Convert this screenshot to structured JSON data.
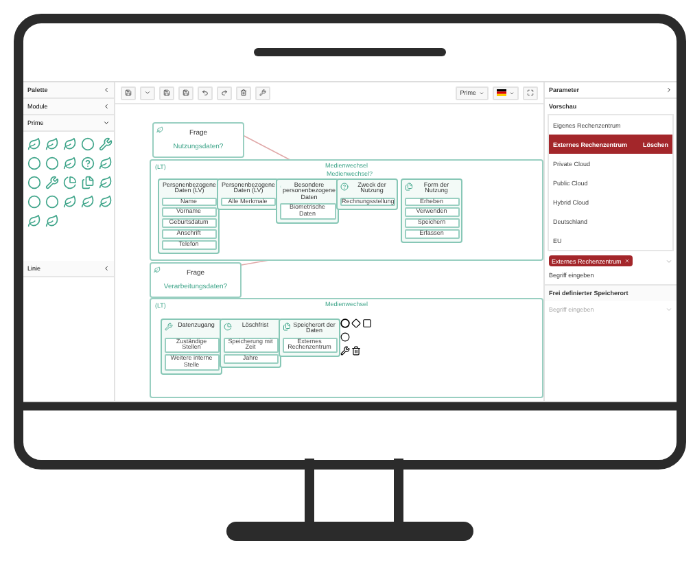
{
  "palette": {
    "title": "Palette",
    "sections": [
      {
        "label": "Module",
        "expanded": false
      },
      {
        "label": "Prime",
        "expanded": true
      },
      {
        "label": "Linie",
        "expanded": false
      }
    ]
  },
  "toolbar": {
    "view": "Prime"
  },
  "canvas": {
    "questions": [
      {
        "title": "Frage",
        "text": "Nutzungsdaten?"
      },
      {
        "title": "Frage",
        "text": "Verarbeitungsdaten?"
      }
    ],
    "groups": [
      {
        "tag": "(LT)",
        "title": "Medienwechsel",
        "note": "Medienwechsel?",
        "nodes": [
          {
            "title": "Personenbezogene Daten (LV)",
            "items": [
              "Name",
              "Vorname",
              "Geburtsdatum",
              "Anschrift",
              "Telefon"
            ]
          },
          {
            "title": "Personenbezogene Daten (LV)",
            "items": [
              "Alle Merkmale"
            ]
          },
          {
            "title": "Besondere personenbezogene Daten",
            "items": [
              "Biometrische Daten"
            ]
          },
          {
            "title": "Zweck der Nutzung",
            "items": [
              "Rechnungsstellung"
            ]
          },
          {
            "title": "Form der Nutzung",
            "items": [
              "Erheben",
              "Verwenden",
              "Speichern",
              "Erfassen"
            ]
          }
        ]
      },
      {
        "tag": "(LT)",
        "title": "Medienwechsel",
        "nodes": [
          {
            "title": "Datenzugang",
            "items": [
              "Zuständige Stellen",
              "Weitere interne Stelle"
            ]
          },
          {
            "title": "Löschfrist",
            "items": [
              "Speicherung mit Zeit",
              "Jahre"
            ]
          },
          {
            "title": "Speicherort der Daten",
            "items": [
              "Externes Rechenzentrum"
            ]
          }
        ]
      }
    ]
  },
  "parameter": {
    "title": "Parameter",
    "section": "Vorschau",
    "options": [
      {
        "label": "Eigenes Rechenzentrum",
        "selected": false
      },
      {
        "label": "Externes Rechenzentrum",
        "selected": true,
        "action": "Löschen"
      },
      {
        "label": "Private Cloud",
        "selected": false
      },
      {
        "label": "Public Cloud",
        "selected": false
      },
      {
        "label": "Hybrid Cloud",
        "selected": false
      },
      {
        "label": "Deutschland",
        "selected": false
      },
      {
        "label": "EU",
        "selected": false
      }
    ],
    "chip": "Externes Rechenzentrum",
    "input_value": "Begriff eingeben",
    "free_section": "Frei definierter Speicherort",
    "free_placeholder": "Begriff eingeben"
  }
}
